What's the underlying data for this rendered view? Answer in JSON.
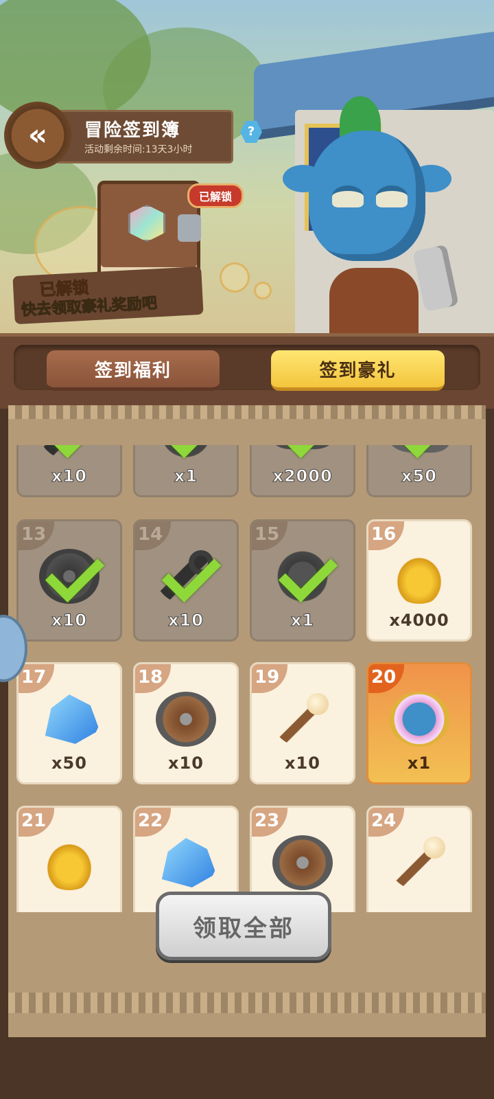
{
  "header": {
    "title": "冒险签到簿",
    "subtitle": "活动剩余时间:13天3小时",
    "help_glyph": "?"
  },
  "book_panel": {
    "unlock_tag": "已解锁",
    "unlock_title": "已解锁",
    "unlock_desc": "快去领取豪礼奖励吧"
  },
  "tabs": [
    {
      "label": "签到福利",
      "active": false
    },
    {
      "label": "签到豪礼",
      "active": true
    }
  ],
  "rewards": [
    {
      "day": "",
      "qty": "x10",
      "icon": "wrench",
      "claimed": true
    },
    {
      "day": "",
      "qty": "x1",
      "icon": "gear",
      "claimed": true
    },
    {
      "day": "",
      "qty": "x2000",
      "icon": "pot",
      "claimed": true
    },
    {
      "day": "",
      "qty": "x50",
      "icon": "stone",
      "claimed": true
    },
    {
      "day": "13",
      "qty": "x10",
      "icon": "shield",
      "claimed": true
    },
    {
      "day": "14",
      "qty": "x10",
      "icon": "wrench",
      "claimed": true
    },
    {
      "day": "15",
      "qty": "x1",
      "icon": "gear",
      "claimed": true
    },
    {
      "day": "16",
      "qty": "x4000",
      "icon": "coins",
      "claimed": false
    },
    {
      "day": "17",
      "qty": "x50",
      "icon": "crystal",
      "claimed": false
    },
    {
      "day": "18",
      "qty": "x10",
      "icon": "shield",
      "claimed": false
    },
    {
      "day": "19",
      "qty": "x10",
      "icon": "staff",
      "claimed": false
    },
    {
      "day": "20",
      "qty": "x1",
      "icon": "avatar",
      "claimed": false,
      "special": true
    },
    {
      "day": "21",
      "qty": "",
      "icon": "coins",
      "claimed": false
    },
    {
      "day": "22",
      "qty": "",
      "icon": "crystal",
      "claimed": false
    },
    {
      "day": "23",
      "qty": "",
      "icon": "shield",
      "claimed": false
    },
    {
      "day": "24",
      "qty": "",
      "icon": "staff",
      "claimed": false
    }
  ],
  "claim_all_label": "领取全部",
  "colors": {
    "claimed_check": "#8ed83a",
    "active_tab": "#f3c53d",
    "special_cell": "#f0934a"
  }
}
